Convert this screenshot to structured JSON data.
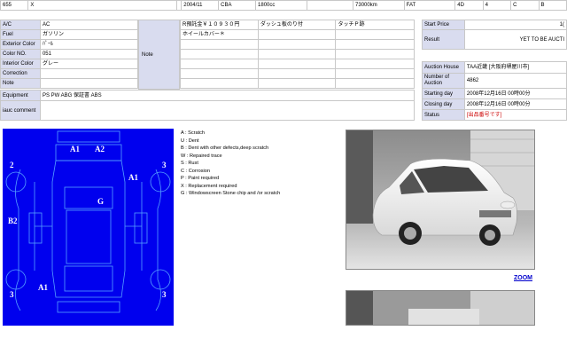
{
  "top_row": [
    "655",
    "X",
    "",
    "2004/11",
    "CBA",
    "1800cc",
    "",
    "73000km",
    "FAT",
    "4D",
    "4",
    "C",
    "B"
  ],
  "left_table": [
    {
      "label": "A/C",
      "value": "AC"
    },
    {
      "label": "Fuel",
      "value": "ガソリン"
    },
    {
      "label": "Exterior Color",
      "value": "ﾊﾟｰﾙ"
    },
    {
      "label": "Color NO.",
      "value": "051"
    },
    {
      "label": "Interior Color",
      "value": "グレー"
    },
    {
      "label": "Correction",
      "value": ""
    },
    {
      "label": "Note",
      "value": ""
    }
  ],
  "equipment": {
    "label": "Equipment",
    "value": "PS PW ABG 保証書 ABS"
  },
  "iauc_comment": {
    "label": "iauc comment",
    "value": ""
  },
  "note_label": "Note",
  "options_grid": [
    [
      "R預託金￥１０９３０円",
      "ダッシュ板のり付",
      "タッチＰ跡"
    ],
    [
      "ホイールカバー＊",
      "",
      ""
    ],
    [
      "",
      "",
      ""
    ],
    [
      "",
      "",
      ""
    ],
    [
      "",
      "",
      ""
    ],
    [
      "",
      "",
      ""
    ],
    [
      "",
      "",
      ""
    ],
    [
      "",
      "",
      ""
    ],
    [
      "",
      "",
      ""
    ]
  ],
  "price": {
    "start_label": "Start Price",
    "start_value": "1(",
    "result_label": "Result",
    "result_value": "YET TO BE AUCTI"
  },
  "auction": [
    {
      "label": "Auction House",
      "value": "TAA近畿 [大阪府堺屋川市]"
    },
    {
      "label": "Number of Auction",
      "value": "4862"
    },
    {
      "label": "Starting day",
      "value": "2008年12月16日 00時00分"
    },
    {
      "label": "Closing day",
      "value": "2008年12月16日 00時00分"
    },
    {
      "label": "Status",
      "value": "[出品番号です]"
    }
  ],
  "diagram_marks": {
    "a1_top": "A1",
    "a2_top": "A2",
    "n2_left": "2",
    "n3_right": "3",
    "a1_right": "A1",
    "g_center": "G",
    "b2_left": "B2",
    "n3_bl": "3",
    "a1_bl": "A1",
    "n3_br": "3"
  },
  "legend": [
    "A : Scratch",
    "U : Dent",
    "B : Dent with other defects,deep scratch",
    "W : Repaired trace",
    "S : Rust",
    "C : Corrosion",
    "P : Paint required",
    "X : Replacement required",
    "G : Windowscreen Stone chip and /or scratch"
  ],
  "zoom_label": "ZOOM",
  "colors": {
    "diagram_bg": "#0000ee",
    "label_bg": "#d9dcef",
    "status_text": "#cc0000",
    "zoom_link": "#0000cc"
  }
}
